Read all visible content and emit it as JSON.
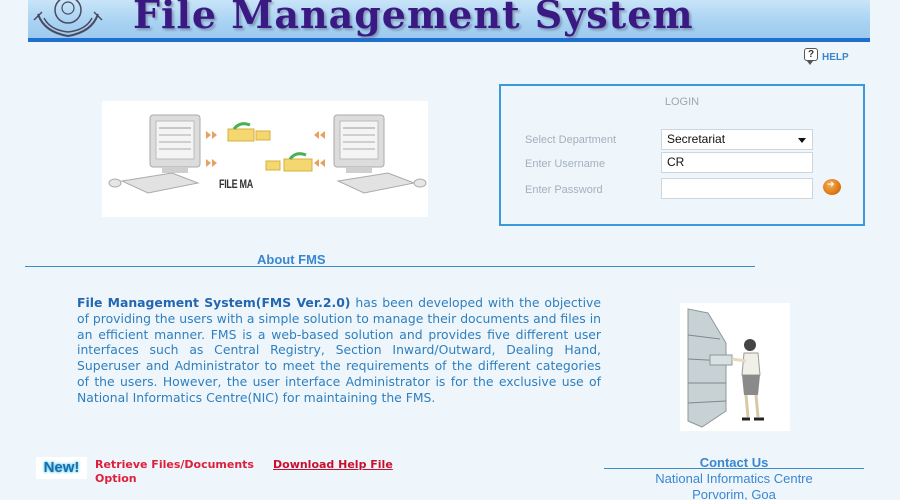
{
  "header": {
    "title": "File Management System",
    "emblem": "government-emblem"
  },
  "help": {
    "icon": "help-question-icon",
    "label": "HELP"
  },
  "illustration": {
    "caption": "FILE MA"
  },
  "login": {
    "title": "LOGIN",
    "department_label": "Select Department",
    "department_value": "Secretariat",
    "username_label": "Enter Username",
    "username_value": "CR",
    "password_label": "Enter Password",
    "password_value": "",
    "submit_icon": "arrow-go-icon"
  },
  "about": {
    "title": "About FMS",
    "text_bold": "File Management System(FMS Ver.2.0)",
    "text_rest": " has been developed with the objective of providing the users with a simple solution to manage their documents and files in an efficient manner. FMS is a web-based solution and provides five different user interfaces such as Central Registry, Section Inward/Outward, Dealing Hand, Superuser and Administrator to meet the requirements of the different categories of the users. However, the user interface Administrator is for the exclusive use of National Informatics Centre(NIC) for maintaining the FMS."
  },
  "bottom": {
    "new_badge": "New!",
    "retrieve_link": "Retrieve Files/Documents Option",
    "download_link": "Download Help File"
  },
  "contact": {
    "title": "Contact Us",
    "line1": "National Informatics Centre",
    "line2": "Porvorim, Goa"
  },
  "colors": {
    "accent_blue": "#1f6fd0",
    "title_purple": "#3a1a82",
    "link_red": "#dd1f3a",
    "text_blue": "#2f7fbe"
  }
}
